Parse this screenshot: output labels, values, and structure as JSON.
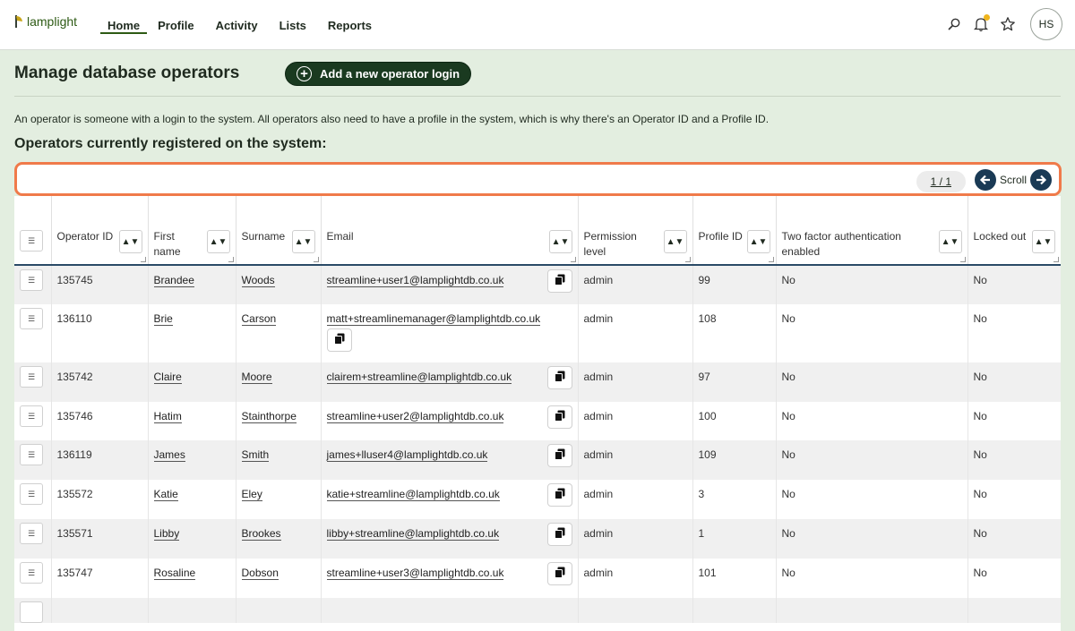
{
  "nav": {
    "logo_text": "lamplight",
    "items": [
      {
        "label": "Home",
        "active": true
      },
      {
        "label": "Profile",
        "active": false
      },
      {
        "label": "Activity",
        "active": false
      },
      {
        "label": "Lists",
        "active": false
      },
      {
        "label": "Reports",
        "active": false
      }
    ],
    "avatar_initials": "HS",
    "icons": [
      "search-icon",
      "bell-icon",
      "star-icon"
    ]
  },
  "header": {
    "title": "Manage database operators",
    "add_button": "Add a new operator login",
    "description": "An operator is someone with a login to the system. All operators also need to have a profile in the system, which is why there's an Operator ID and a Profile ID.",
    "section_title": "Operators currently registered on the system:"
  },
  "scroll": {
    "pager": "1 / 1",
    "label": "Scroll"
  },
  "table": {
    "columns": [
      {
        "key": "operator_id",
        "label": "Operator ID"
      },
      {
        "key": "first_name",
        "label": "First name"
      },
      {
        "key": "surname",
        "label": "Surname"
      },
      {
        "key": "email",
        "label": "Email"
      },
      {
        "key": "permission",
        "label": "Permission level"
      },
      {
        "key": "profile_id",
        "label": "Profile ID"
      },
      {
        "key": "two_factor",
        "label": "Two factor authentication enabled"
      },
      {
        "key": "locked",
        "label": "Locked out"
      }
    ],
    "rows": [
      {
        "operator_id": "135745",
        "first_name": "Brandee",
        "surname": "Woods",
        "email": "streamline+user1@lamplightdb.co.uk",
        "permission": "admin",
        "profile_id": "99",
        "two_factor": "No",
        "locked": "No"
      },
      {
        "operator_id": "136110",
        "first_name": "Brie",
        "surname": "Carson",
        "email": "matt+streamlinemanager@lamplightdb.co.uk",
        "permission": "admin",
        "profile_id": "108",
        "two_factor": "No",
        "locked": "No"
      },
      {
        "operator_id": "135742",
        "first_name": "Claire",
        "surname": "Moore",
        "email": "clairem+streamline@lamplightdb.co.uk",
        "permission": "admin",
        "profile_id": "97",
        "two_factor": "No",
        "locked": "No"
      },
      {
        "operator_id": "135746",
        "first_name": "Hatim",
        "surname": "Stainthorpe",
        "email": "streamline+user2@lamplightdb.co.uk",
        "permission": "admin",
        "profile_id": "100",
        "two_factor": "No",
        "locked": "No"
      },
      {
        "operator_id": "136119",
        "first_name": "James",
        "surname": "Smith",
        "email": "james+lluser4@lamplightdb.co.uk",
        "permission": "admin",
        "profile_id": "109",
        "two_factor": "No",
        "locked": "No"
      },
      {
        "operator_id": "135572",
        "first_name": "Katie",
        "surname": "Eley",
        "email": "katie+streamline@lamplightdb.co.uk",
        "permission": "admin",
        "profile_id": "3",
        "two_factor": "No",
        "locked": "No"
      },
      {
        "operator_id": "135571",
        "first_name": "Libby",
        "surname": "Brookes",
        "email": "libby+streamline@lamplightdb.co.uk",
        "permission": "admin",
        "profile_id": "1",
        "two_factor": "No",
        "locked": "No"
      },
      {
        "operator_id": "135747",
        "first_name": "Rosaline",
        "surname": "Dobson",
        "email": "streamline+user3@lamplightdb.co.uk",
        "permission": "admin",
        "profile_id": "101",
        "two_factor": "No",
        "locked": "No"
      }
    ]
  },
  "colors": {
    "page_bg": "#e3eee0",
    "button_dark": "#1a3a20",
    "highlight": "#f07a4a",
    "scroll_btn": "#1a3a55",
    "notification_dot": "#f0b51c"
  }
}
